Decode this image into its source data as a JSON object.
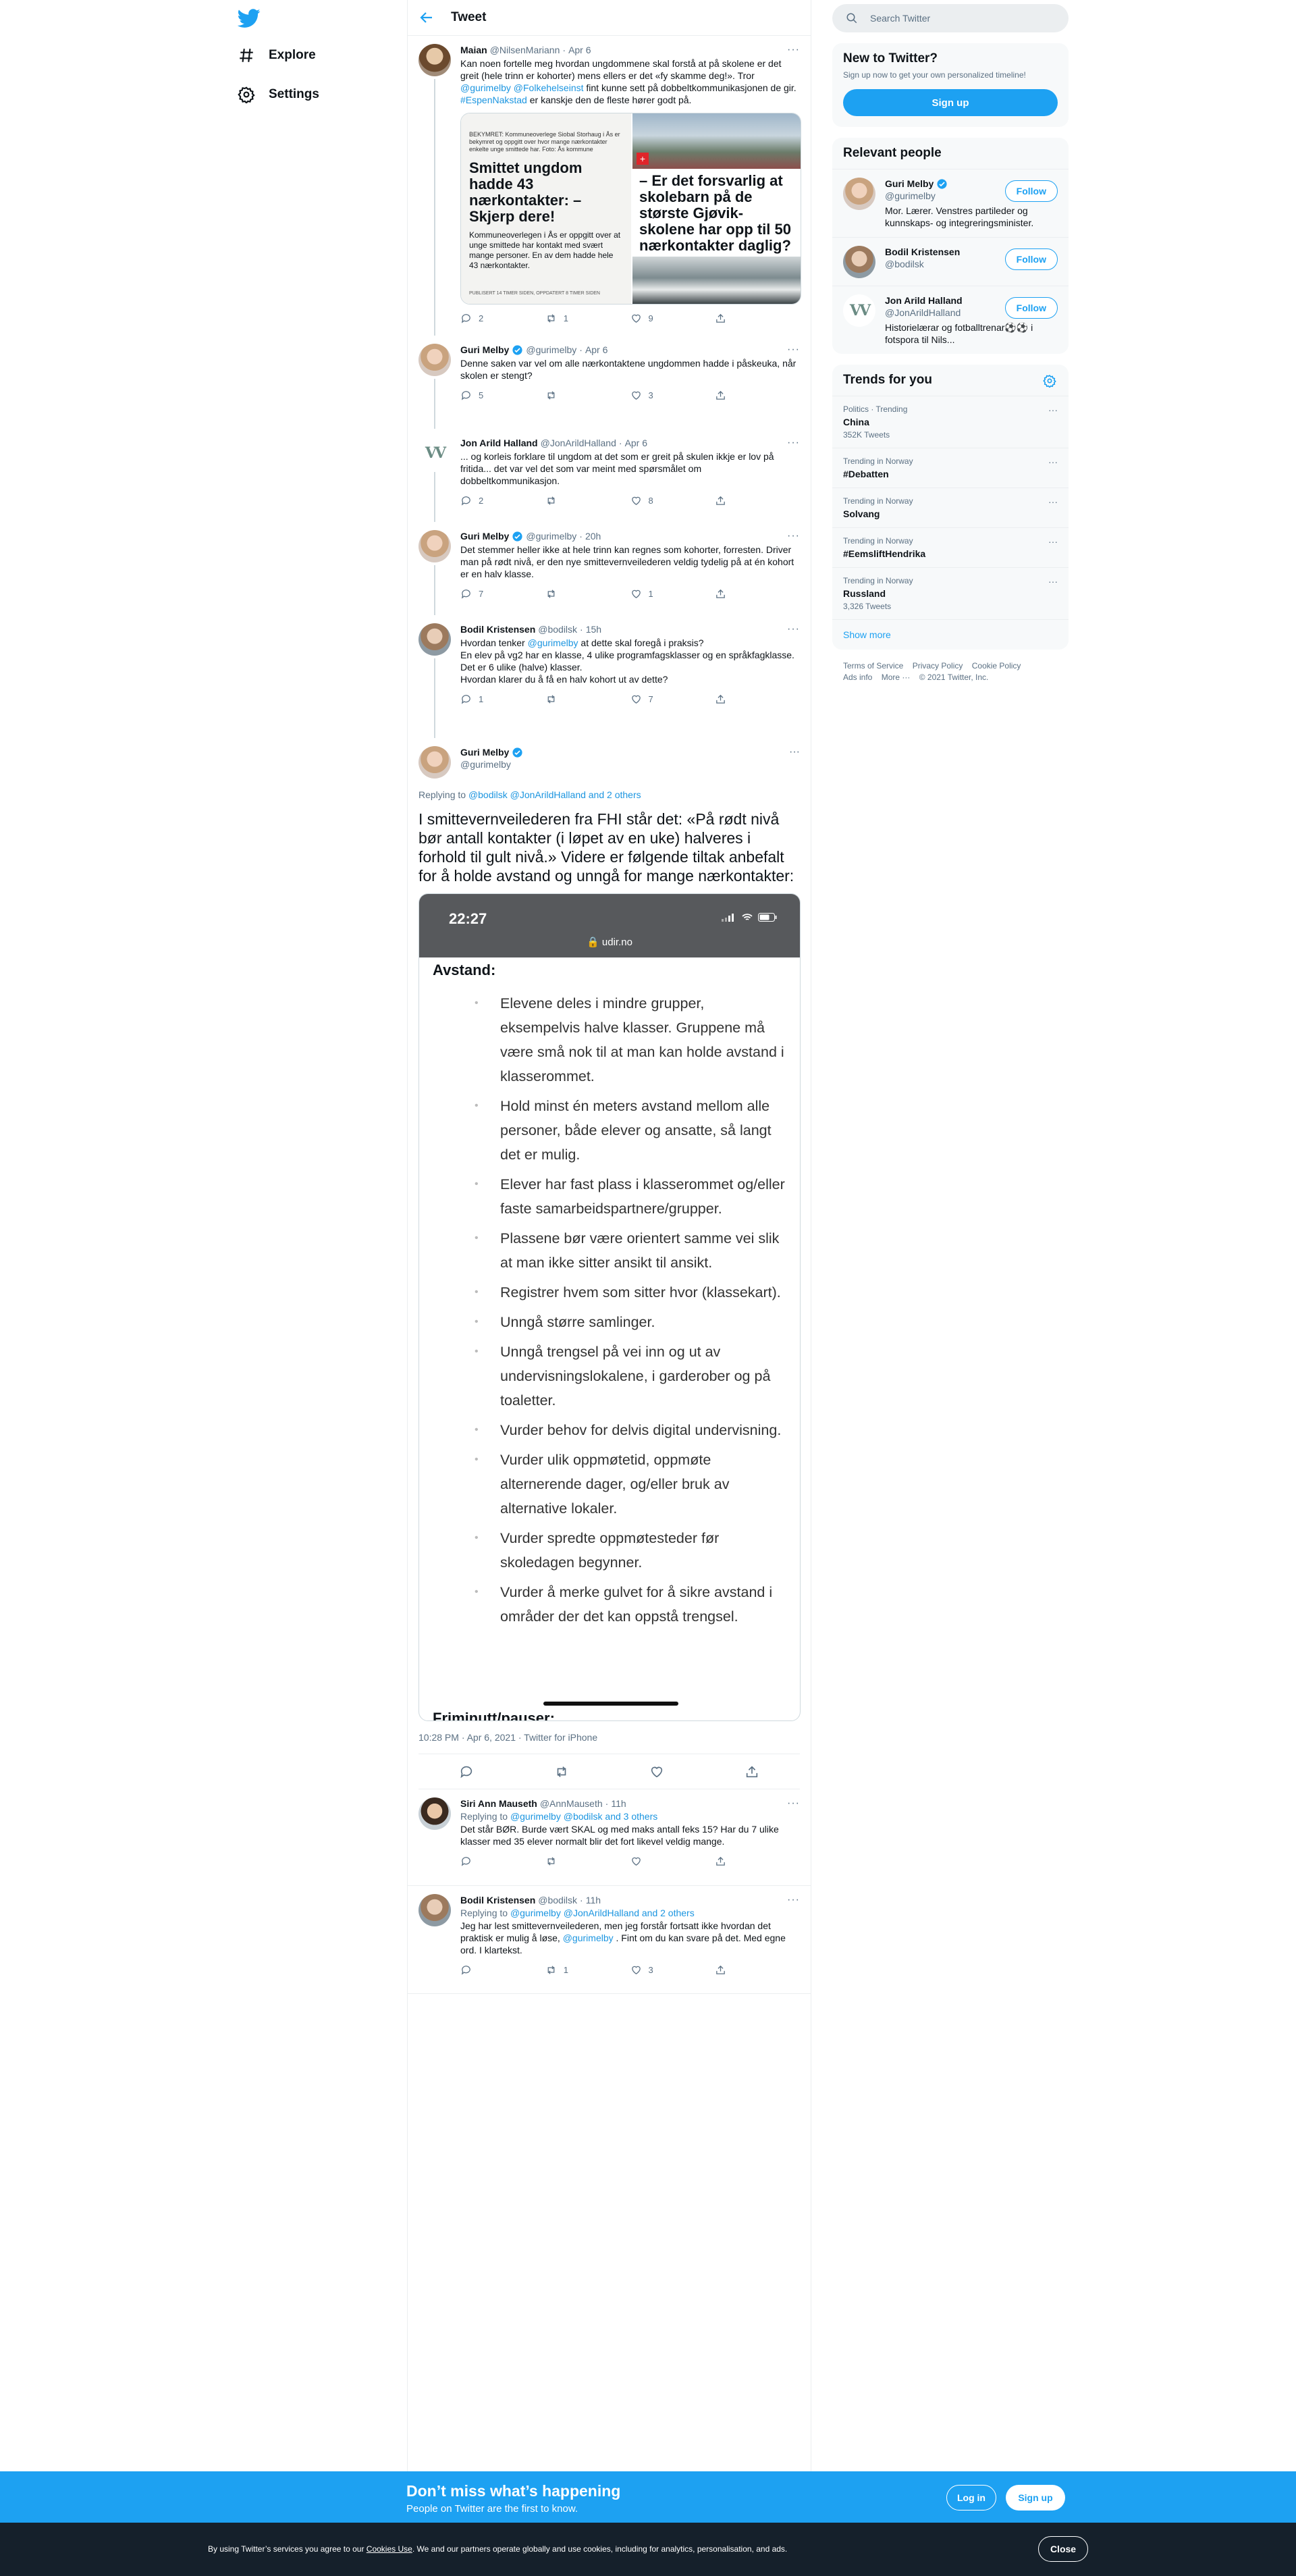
{
  "nav": {
    "explore": "Explore",
    "settings": "Settings"
  },
  "topbar": {
    "title": "Tweet"
  },
  "thread": [
    {
      "name": "Maian",
      "handle": "@NilsenMariann",
      "date": "Apr 6",
      "verified": false,
      "text_before": "Kan noen fortelle meg hvordan ungdommene skal forstå at på skolene er det greit (hele trinn er kohorter) mens ellers er det «fy skamme deg!». Tror ",
      "mention1": "@gurimelby",
      "mention2": "@Folkehelseinst",
      "text_mid": " fint kunne sett på dobbeltkommunikasjonen de gir. ",
      "hashtag": "#EspenNakstad",
      "text_after": " er kanskje den de fleste hører godt på.",
      "image": {
        "left_kicker": "BEKYMRET: Kommuneoverlege Siobal Storhaug i Ås er bekymret og oppgitt over hvor mange nærkontakter enkelte unge smittede har. Foto: Ås kommune",
        "left_headline": "Smittet ungdom hadde 43 nærkontakter: – Skjerp dere!",
        "left_lede": "Kommuneoverlegen i Ås er oppgitt over at unge smittede har kontakt med svært mange personer. En av dem hadde hele 43 nærkontakter.",
        "left_foot": "PUBLISERT 14 TIMER SIDEN, OPPDATERT 8 TIMER SIDEN",
        "right_headline": "– Er det forsvarlig at skolebarn på de største Gjøvik-skolene har opp til 50 nærkontakter daglig?"
      },
      "reply_count": "2",
      "retweet_count": "1",
      "like_count": "9"
    },
    {
      "name": "Guri Melby",
      "handle": "@gurimelby",
      "date": "Apr 6",
      "verified": true,
      "text": "Denne saken var vel om alle nærkontaktene ungdommen hadde i påskeuka, når skolen er stengt?",
      "reply_count": "5",
      "retweet_count": "",
      "like_count": "3"
    },
    {
      "name": "Jon Arild Halland",
      "handle": "@JonArildHalland",
      "date": "Apr 6",
      "verified": false,
      "text": "... og korleis forklare til ungdom at det som er greit på skulen ikkje er lov på fritida... det var vel det som var meint med spørsmålet om dobbeltkommunikasjon.",
      "reply_count": "2",
      "retweet_count": "",
      "like_count": "8"
    },
    {
      "name": "Guri Melby",
      "handle": "@gurimelby",
      "date": "20h",
      "verified": true,
      "text": "Det stemmer heller ikke at hele trinn kan regnes som kohorter, forresten. Driver man på rødt nivå, er den nye smittevernveilederen veldig tydelig på at én kohort er en halv klasse.",
      "reply_count": "7",
      "retweet_count": "",
      "like_count": "1"
    },
    {
      "name": "Bodil Kristensen",
      "handle": "@bodilsk",
      "date": "15h",
      "verified": false,
      "text_before": "Hvordan tenker ",
      "mention1": "@gurimelby",
      "text_after": " at dette skal foregå i praksis?\nEn elev på vg2 har en klasse, 4 ulike programfagsklasser og en språkfagklasse.\nDet er 6 ulike (halve) klasser.\nHvordan klarer du å få en halv kohort ut av dette?",
      "reply_count": "1",
      "retweet_count": "",
      "like_count": "7"
    }
  ],
  "main_tweet": {
    "name": "Guri Melby",
    "handle": "@gurimelby",
    "replying_label": "Replying to",
    "replying_to": "@bodilsk @JonArildHalland and 2 others",
    "text": "I smittevernveilederen fra FHI står det: «På rødt nivå bør antall kontakter (i løpet av en uke) halveres i forhold til gult nivå.» Videre er følgende tiltak anbefalt for å holde avstand og unngå for mange nærkontakter:",
    "phone": {
      "time": "22:27",
      "url": "udir.no",
      "section": "Avstand:",
      "bullets": [
        "Elevene deles i mindre grupper, eksempelvis halve klasser. Gruppene må være små nok til at man kan holde avstand i klasserommet.",
        "Hold minst én meters avstand mellom alle personer, både elever og ansatte, så langt det er mulig.",
        "Elever har fast plass i klasserommet og/eller faste samarbeidspartnere/grupper.",
        "Plassene bør være orientert samme vei slik at man ikke sitter ansikt til ansikt.",
        "Registrer hvem som sitter hvor (klassekart).",
        "Unngå større samlinger.",
        "Unngå trengsel på vei inn og ut av undervisningslokalene, i garderober og på toaletter.",
        "Vurder behov for delvis digital undervisning.",
        "Vurder ulik oppmøtetid, oppmøte alternerende dager, og/eller bruk av alternative lokaler.",
        "Vurder spredte oppmøtesteder før skoledagen begynner.",
        "Vurder å merke gulvet for å sikre avstand i områder der det kan oppstå trengsel."
      ],
      "section2": "Friminutt/pauser:"
    },
    "timestamp": "10:28 PM · Apr 6, 2021 · Twitter for iPhone"
  },
  "replies": [
    {
      "name": "Siri Ann Mauseth",
      "handle": "@AnnMauseth",
      "date": "11h",
      "replying_label": "Replying to",
      "replying_to": "@gurimelby @bodilsk and 3 others",
      "text": "Det står BØR. Burde vært SKAL og med maks antall feks 15? Har du 7 ulike klasser med 35 elever normalt blir det fort likevel veldig mange.",
      "reply_count": "",
      "retweet_count": "",
      "like_count": ""
    },
    {
      "name": "Bodil Kristensen",
      "handle": "@bodilsk",
      "date": "11h",
      "replying_label": "Replying to",
      "replying_to": "@gurimelby @JonArildHalland and 2 others",
      "text_before": "Jeg har lest smittevernveilederen, men jeg forstår fortsatt ikke hvordan det praktisk er mulig å løse, ",
      "mention1": "@gurimelby",
      "text_after": " . Fint om du kan svare på det. Med egne ord. I klartekst.",
      "reply_count": "",
      "retweet_count": "1",
      "like_count": "3"
    }
  ],
  "sidebar": {
    "search_placeholder": "Search Twitter",
    "new_title": "New to Twitter?",
    "new_sub": "Sign up now to get your own personalized timeline!",
    "signup": "Sign up",
    "relevant_title": "Relevant people",
    "people": [
      {
        "name": "Guri Melby",
        "handle": "@gurimelby",
        "verified": true,
        "bio": "Mor. Lærer. Venstres partileder og kunnskaps- og integreringsminister.",
        "follow": "Follow"
      },
      {
        "name": "Bodil Kristensen",
        "handle": "@bodilsk",
        "verified": false,
        "bio": "",
        "follow": "Follow"
      },
      {
        "name": "Jon Arild Halland",
        "handle": "@JonArildHalland",
        "verified": false,
        "bio": "Historielærar og fotballtrenar⚽⚽ i fotspora til Nils...",
        "follow": "Follow"
      }
    ],
    "trends_title": "Trends for you",
    "trends": [
      {
        "context": "Politics · Trending",
        "name": "China",
        "count": "352K Tweets"
      },
      {
        "context": "Trending in Norway",
        "name": "#Debatten",
        "count": ""
      },
      {
        "context": "Trending in Norway",
        "name": "Solvang",
        "count": ""
      },
      {
        "context": "Trending in Norway",
        "name": "#EemsliftHendrika",
        "count": ""
      },
      {
        "context": "Trending in Norway",
        "name": "Russland",
        "count": "3,326 Tweets"
      }
    ],
    "show_more": "Show more",
    "footer": [
      "Terms of Service",
      "Privacy Policy",
      "Cookie Policy",
      "Ads info",
      "More ···",
      "© 2021 Twitter, Inc."
    ]
  },
  "cta": {
    "title": "Don’t miss what’s happening",
    "subtitle": "People on Twitter are the first to know.",
    "login": "Log in",
    "signup": "Sign up"
  },
  "cookie": {
    "text_before": "By using Twitter’s services you agree to our ",
    "link": "Cookies Use",
    "text_after": ". We and our partners operate globally and use cookies, including for analytics, personalisation, and ads.",
    "close": "Close"
  },
  "colors": {
    "accent": "#1da1f2",
    "link": "#1b95e0",
    "cookie_bg": "#15202b"
  }
}
